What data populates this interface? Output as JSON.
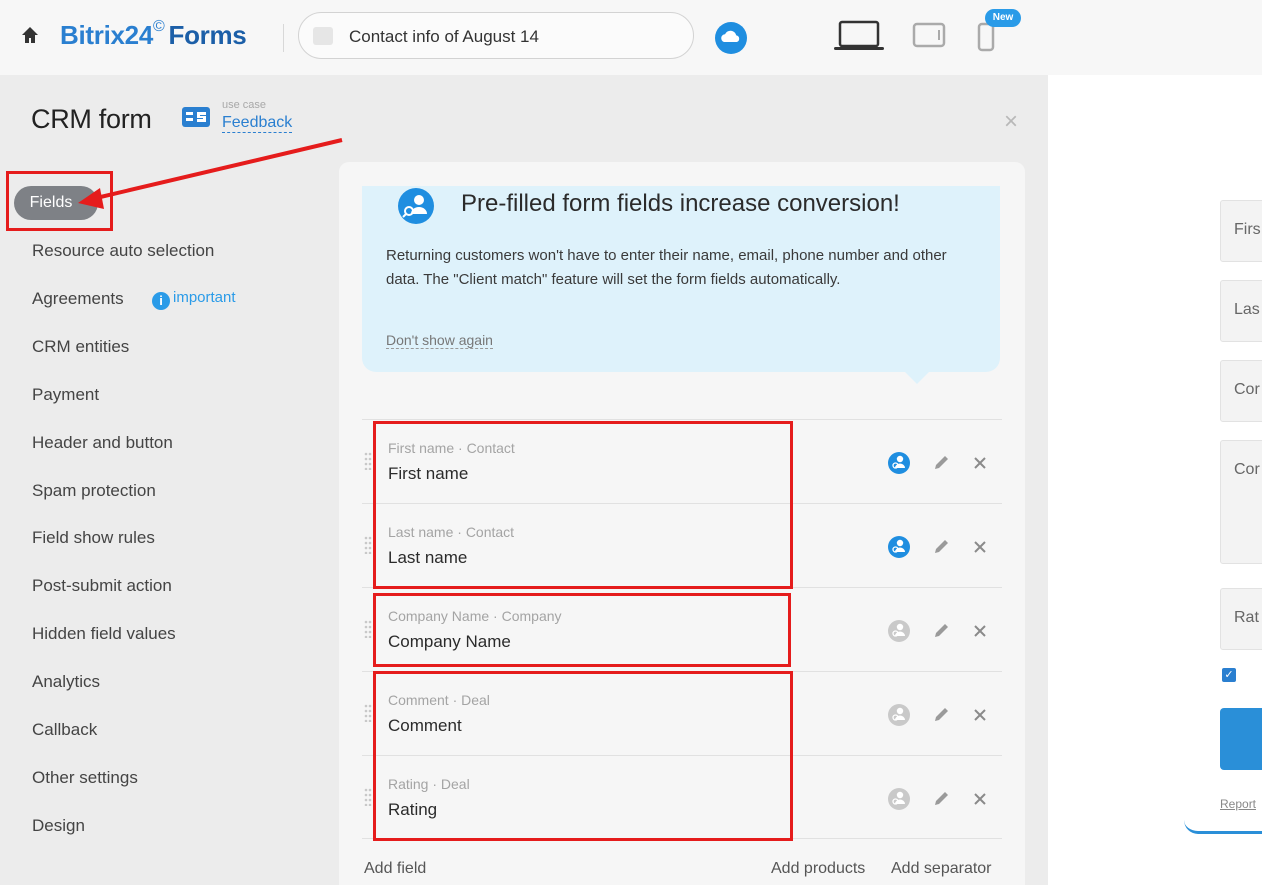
{
  "header": {
    "brand_name": "Bitrix24",
    "brand_mark": "©",
    "brand_product": "Forms",
    "form_title": "Contact info of August 14",
    "new_badge": "New"
  },
  "panel": {
    "title": "CRM form",
    "use_case_label": "use case",
    "use_case_value": "Feedback",
    "close": "×"
  },
  "nav": {
    "active": "Fields",
    "items": [
      "Resource auto selection",
      "Agreements",
      "CRM entities",
      "Payment",
      "Header and button",
      "Spam protection",
      "Field show rules",
      "Post-submit action",
      "Hidden field values",
      "Analytics",
      "Callback",
      "Other settings",
      "Design"
    ],
    "important_badge": "important",
    "important_icon": "i"
  },
  "promo": {
    "title": "Pre-filled form fields increase conversion!",
    "text": "Returning customers won't have to enter their name, email, phone number and other data. The \"Client match\" feature will set the form fields automatically.",
    "dismiss": "Don't show again"
  },
  "fields": [
    {
      "meta": "First name · Contact",
      "name": "First name",
      "match_active": true
    },
    {
      "meta": "Last name · Contact",
      "name": "Last name",
      "match_active": true
    },
    {
      "meta": "Company Name · Company",
      "name": "Company Name",
      "match_active": false
    },
    {
      "meta": "Comment · Deal",
      "name": "Comment",
      "match_active": false
    },
    {
      "meta": "Rating · Deal",
      "name": "Rating",
      "match_active": false
    }
  ],
  "field_actions": {
    "add_field": "Add field",
    "add_products": "Add products",
    "add_separator": "Add separator"
  },
  "preview": {
    "fields": [
      "Firs",
      "Las",
      "Cor",
      "Cor",
      "Rat"
    ],
    "check_mark": "✓",
    "report": "Report"
  },
  "colors": {
    "accent": "#2a7fd0",
    "annotation": "#e51c1c",
    "active_nav": "#7e8186",
    "promo_bg": "#def2fb"
  }
}
